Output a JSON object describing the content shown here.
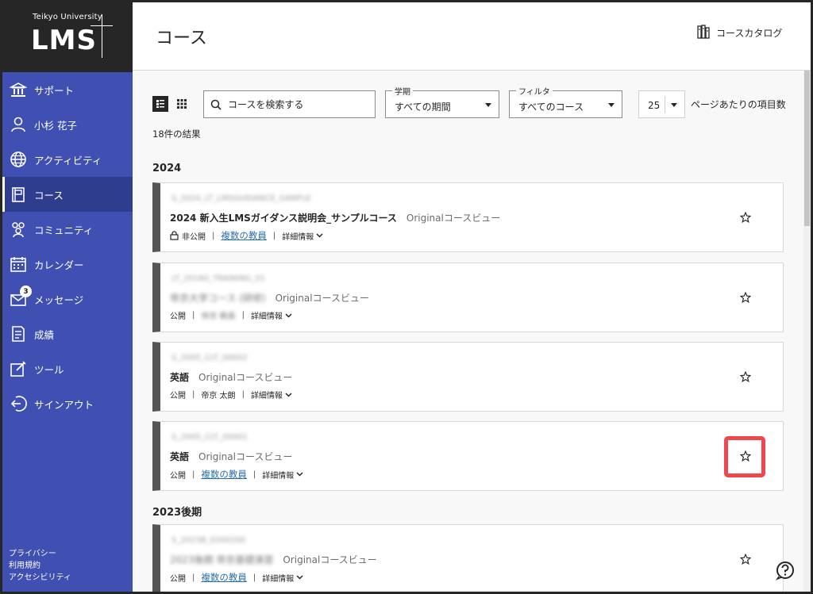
{
  "sidebar": {
    "logo_university": "Teikyo University",
    "logo_text": "LMS",
    "items": [
      {
        "label": "サポート",
        "icon": "institution-icon"
      },
      {
        "label": "小杉 花子",
        "icon": "user-icon"
      },
      {
        "label": "アクティビティ",
        "icon": "globe-icon"
      },
      {
        "label": "コース",
        "icon": "course-icon"
      },
      {
        "label": "コミュニティ",
        "icon": "community-icon"
      },
      {
        "label": "カレンダー",
        "icon": "calendar-icon"
      },
      {
        "label": "メッセージ",
        "icon": "envelope-icon",
        "badge": "3"
      },
      {
        "label": "成績",
        "icon": "grades-icon"
      },
      {
        "label": "ツール",
        "icon": "tools-icon"
      },
      {
        "label": "サインアウト",
        "icon": "sign-out-icon"
      }
    ],
    "footer": [
      "プライバシー",
      "利用規約",
      "アクセシビリティ"
    ]
  },
  "header": {
    "title": "コース",
    "catalog_label": "コースカタログ"
  },
  "filters": {
    "search_placeholder": "コースを検索する",
    "term_legend": "学期",
    "term_value": "すべての期間",
    "filter_legend": "フィルタ",
    "filter_value": "すべてのコース",
    "per_page_value": "25",
    "per_page_label": "ページあたりの項目数"
  },
  "results_count": "18件の結果",
  "groups": [
    {
      "year": "2024"
    },
    {
      "year": "2023後期"
    }
  ],
  "courses": [
    {
      "id": "S_2024_LT_LMSGUIDANCE_SAMPLE",
      "name": "2024 新入生LMSガイダンス説明会_サンプルコース",
      "view": "Originalコースビュー",
      "status": "非公開",
      "instructor": "複数の教員",
      "details": "詳細情報",
      "locked": true
    },
    {
      "id": "LT_20160_TRAINING_01",
      "name": "帝京大学コース (研修)",
      "view": "Originalコースビュー",
      "status": "公開",
      "instructor": "帝京 教員",
      "details": "詳細情報"
    },
    {
      "id": "S_2005_CLT_00002",
      "name": "英語",
      "view": "Originalコースビュー",
      "status": "公開",
      "instructor": "帝京 太朗",
      "details": "詳細情報"
    },
    {
      "id": "S_2005_CLT_00001",
      "name": "英語",
      "view": "Originalコースビュー",
      "status": "公開",
      "instructor": "複数の教員",
      "details": "詳細情報"
    },
    {
      "id": "S_2023B_0200200",
      "name": "2023後期 帝京基礎演習",
      "view": "Originalコースビュー",
      "status": "公開",
      "instructor": "複数の教員",
      "details": "詳細情報"
    }
  ],
  "colors": {
    "sidebar": "#3f4fb2",
    "active": "#2f3d8e",
    "link": "#2a6fa7",
    "highlight": "#f0474e"
  }
}
